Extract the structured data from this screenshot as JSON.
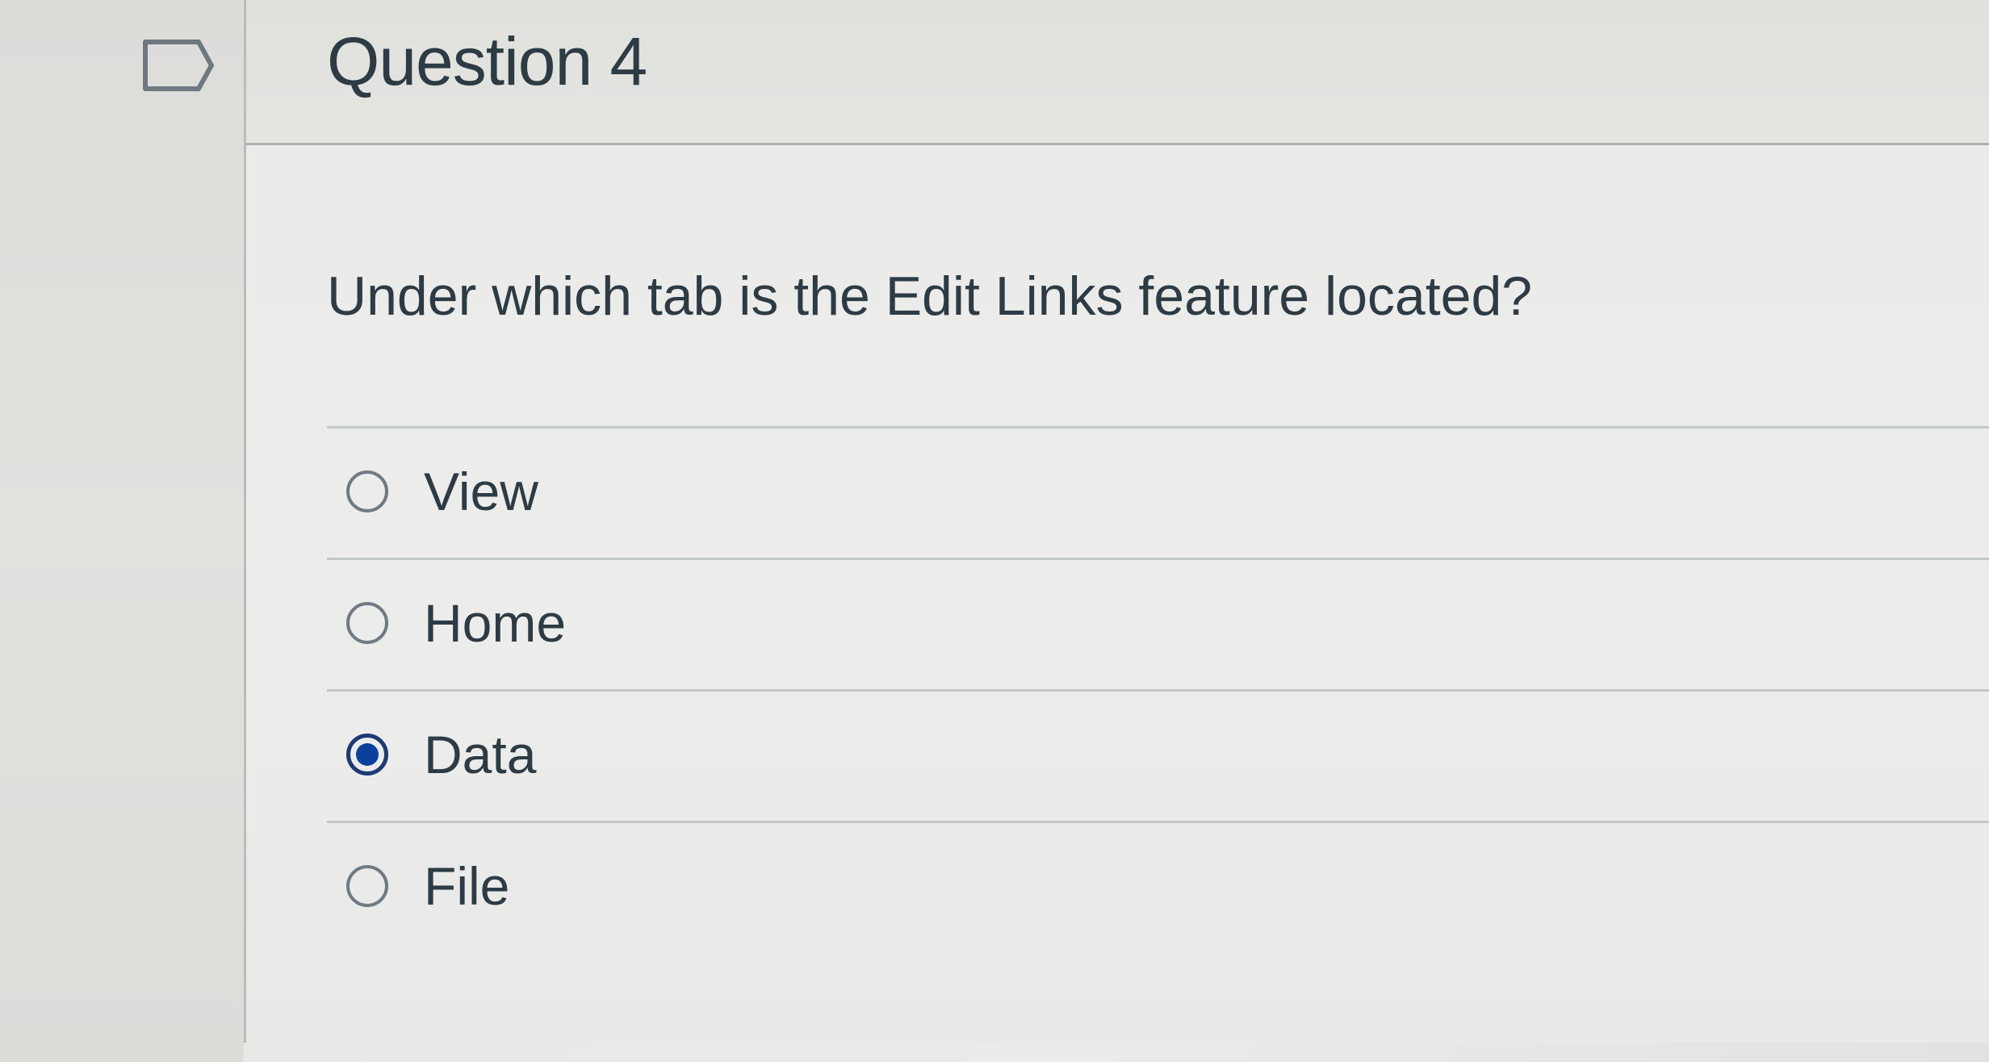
{
  "question": {
    "title": "Question 4",
    "text": "Under which tab is the Edit Links feature located?",
    "flag_icon": "flag-outline-icon"
  },
  "answers": [
    {
      "label": "View",
      "selected": false
    },
    {
      "label": "Home",
      "selected": false
    },
    {
      "label": "Data",
      "selected": true
    },
    {
      "label": "File",
      "selected": false
    }
  ],
  "colors": {
    "selected_radio": "#0b3f9c",
    "text": "#2d3b45",
    "radio_border": "#707a82"
  }
}
